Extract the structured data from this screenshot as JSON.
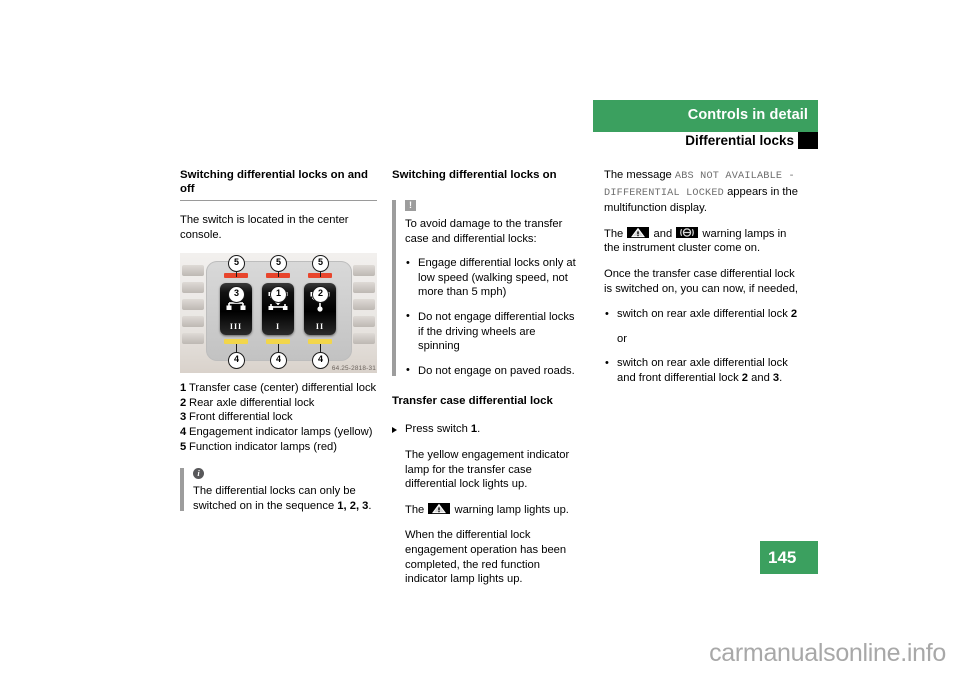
{
  "header": {
    "band_title": "Controls in detail",
    "sub_title": "Differential locks"
  },
  "page_number": "145",
  "watermark": "carmanualsonline.info",
  "col1": {
    "heading": "Switching differential locks on and off",
    "intro": "The switch is located in the center console.",
    "figure": {
      "code": "64.25-2818-31",
      "callouts_top": [
        "5",
        "5",
        "5"
      ],
      "callouts_bottom": [
        "4",
        "4",
        "4"
      ],
      "switch_badges": [
        "3",
        "1",
        "2"
      ],
      "switch_romans": [
        "III",
        "I",
        "II"
      ],
      "lamp_red_color": "#e8452c",
      "lamp_yellow_color": "#f2d64b"
    },
    "legend": [
      {
        "num": "1",
        "text": "Transfer case (center) differential lock"
      },
      {
        "num": "2",
        "text": "Rear axle differential lock"
      },
      {
        "num": "3",
        "text": "Front differential lock"
      },
      {
        "num": "4",
        "text": "Engagement indicator lamps (yellow)"
      },
      {
        "num": "5",
        "text": "Function indicator lamps (red)"
      }
    ],
    "note": {
      "icon": "info-icon",
      "icon_glyph": "i",
      "line1": "The differential locks can only be",
      "line2_pre": "switched on in the sequence ",
      "line2_seq": "1, 2, 3",
      "line2_post": "."
    }
  },
  "col2": {
    "heading": "Switching differential locks on",
    "warning": {
      "icon": "exclamation-icon",
      "icon_glyph": "!",
      "intro": "To avoid damage to the transfer case and differential locks:",
      "bullets": [
        "Engage differential locks only at low speed (walking speed, not more than 5 mph)",
        "Do not engage differential locks if the driving wheels are spinning",
        "Do not engage on paved roads."
      ]
    },
    "subheading": "Transfer case differential lock",
    "step_pre": "Press switch ",
    "step_num": "1",
    "step_post": ".",
    "para1": "The yellow engagement indicator lamp for the transfer case differential lock lights up.",
    "para2_pre": "The ",
    "para2_post": " warning lamp lights up.",
    "para3": "When the differential lock engagement operation has been completed, the red function indicator lamp lights up."
  },
  "col3": {
    "msg_pre": "The message ",
    "msg_mono": "ABS NOT AVAILABLE - DIFFERENTIAL LOCKED",
    "msg_post": " appears in the multifunction display.",
    "lamps_pre": "The ",
    "lamps_mid": " and ",
    "lamps_post": " warning lamps in the instrument cluster come on.",
    "para_once": "Once the transfer case differential lock is switched on, you can now, if needed,",
    "bullet1_pre": "switch on rear axle differential lock ",
    "bullet1_num": "2",
    "or_text": "or",
    "bullet2_pre": "switch on rear axle differential lock and front differential lock ",
    "bullet2_num_a": "2",
    "bullet2_mid": " and ",
    "bullet2_num_b": "3",
    "bullet2_post": "."
  }
}
